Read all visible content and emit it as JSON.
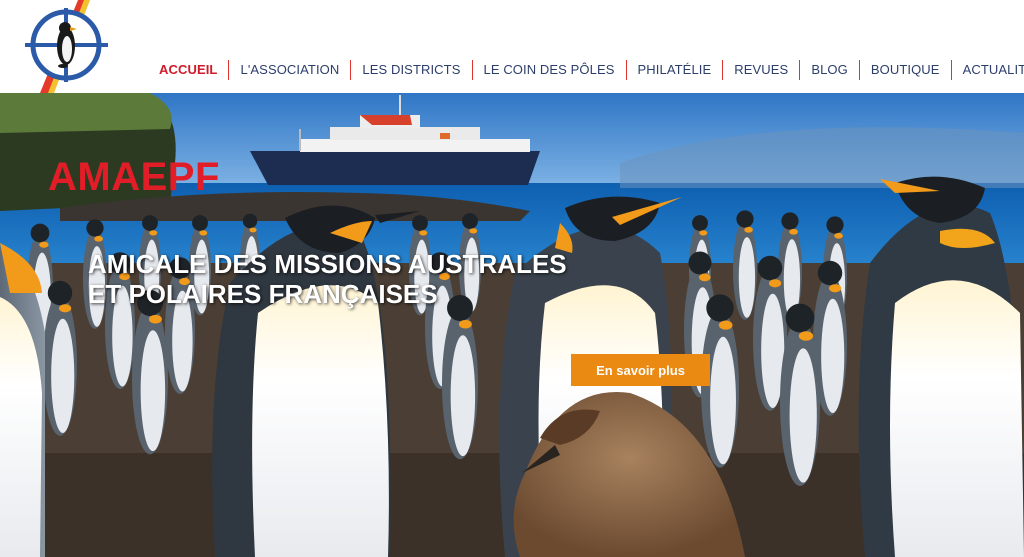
{
  "nav": {
    "items": [
      {
        "label": "ACCUEIL",
        "active": true
      },
      {
        "label": "L'ASSOCIATION"
      },
      {
        "label": "LES DISTRICTS"
      },
      {
        "label": "LE COIN DES PÔLES"
      },
      {
        "label": "PHILATÉLIE"
      },
      {
        "label": "REVUES"
      },
      {
        "label": "BLOG"
      },
      {
        "label": "BOUTIQUE"
      },
      {
        "label": "ACTUALITÉS"
      }
    ]
  },
  "hero": {
    "brand": "AMAEPF",
    "subtitle_line1": "AMICALE DES MISSIONS AUSTRALES",
    "subtitle_line2": "ET POLAIRES FRANÇAISES",
    "cta_label": "En savoir plus"
  },
  "colors": {
    "brand_red": "#e11d28",
    "nav_text": "#2c3e6b",
    "nav_separator": "#e0342e",
    "cta_orange": "#ea8a12"
  },
  "icons": {
    "logo": "penguin-crosshair-logo"
  }
}
